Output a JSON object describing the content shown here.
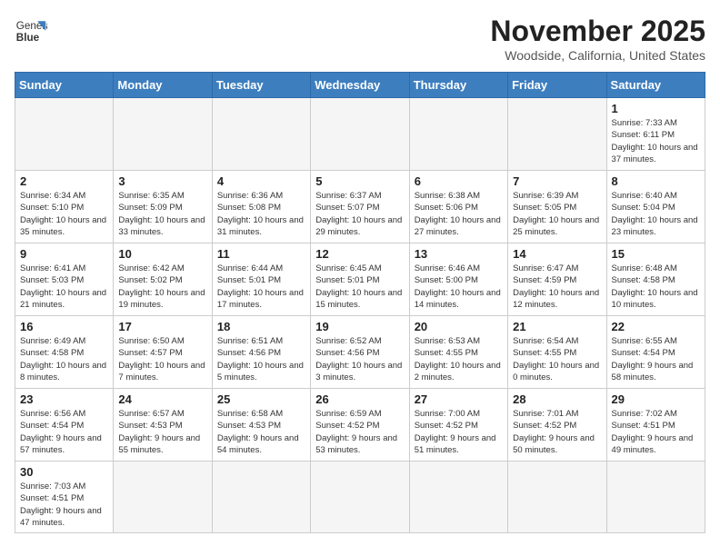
{
  "logo": {
    "text_normal": "General",
    "text_bold": "Blue"
  },
  "header": {
    "month": "November 2025",
    "location": "Woodside, California, United States"
  },
  "weekdays": [
    "Sunday",
    "Monday",
    "Tuesday",
    "Wednesday",
    "Thursday",
    "Friday",
    "Saturday"
  ],
  "weeks": [
    [
      {
        "day": "",
        "info": ""
      },
      {
        "day": "",
        "info": ""
      },
      {
        "day": "",
        "info": ""
      },
      {
        "day": "",
        "info": ""
      },
      {
        "day": "",
        "info": ""
      },
      {
        "day": "",
        "info": ""
      },
      {
        "day": "1",
        "info": "Sunrise: 7:33 AM\nSunset: 6:11 PM\nDaylight: 10 hours\nand 37 minutes."
      }
    ],
    [
      {
        "day": "2",
        "info": "Sunrise: 6:34 AM\nSunset: 5:10 PM\nDaylight: 10 hours\nand 35 minutes."
      },
      {
        "day": "3",
        "info": "Sunrise: 6:35 AM\nSunset: 5:09 PM\nDaylight: 10 hours\nand 33 minutes."
      },
      {
        "day": "4",
        "info": "Sunrise: 6:36 AM\nSunset: 5:08 PM\nDaylight: 10 hours\nand 31 minutes."
      },
      {
        "day": "5",
        "info": "Sunrise: 6:37 AM\nSunset: 5:07 PM\nDaylight: 10 hours\nand 29 minutes."
      },
      {
        "day": "6",
        "info": "Sunrise: 6:38 AM\nSunset: 5:06 PM\nDaylight: 10 hours\nand 27 minutes."
      },
      {
        "day": "7",
        "info": "Sunrise: 6:39 AM\nSunset: 5:05 PM\nDaylight: 10 hours\nand 25 minutes."
      },
      {
        "day": "8",
        "info": "Sunrise: 6:40 AM\nSunset: 5:04 PM\nDaylight: 10 hours\nand 23 minutes."
      }
    ],
    [
      {
        "day": "9",
        "info": "Sunrise: 6:41 AM\nSunset: 5:03 PM\nDaylight: 10 hours\nand 21 minutes."
      },
      {
        "day": "10",
        "info": "Sunrise: 6:42 AM\nSunset: 5:02 PM\nDaylight: 10 hours\nand 19 minutes."
      },
      {
        "day": "11",
        "info": "Sunrise: 6:44 AM\nSunset: 5:01 PM\nDaylight: 10 hours\nand 17 minutes."
      },
      {
        "day": "12",
        "info": "Sunrise: 6:45 AM\nSunset: 5:01 PM\nDaylight: 10 hours\nand 15 minutes."
      },
      {
        "day": "13",
        "info": "Sunrise: 6:46 AM\nSunset: 5:00 PM\nDaylight: 10 hours\nand 14 minutes."
      },
      {
        "day": "14",
        "info": "Sunrise: 6:47 AM\nSunset: 4:59 PM\nDaylight: 10 hours\nand 12 minutes."
      },
      {
        "day": "15",
        "info": "Sunrise: 6:48 AM\nSunset: 4:58 PM\nDaylight: 10 hours\nand 10 minutes."
      }
    ],
    [
      {
        "day": "16",
        "info": "Sunrise: 6:49 AM\nSunset: 4:58 PM\nDaylight: 10 hours\nand 8 minutes."
      },
      {
        "day": "17",
        "info": "Sunrise: 6:50 AM\nSunset: 4:57 PM\nDaylight: 10 hours\nand 7 minutes."
      },
      {
        "day": "18",
        "info": "Sunrise: 6:51 AM\nSunset: 4:56 PM\nDaylight: 10 hours\nand 5 minutes."
      },
      {
        "day": "19",
        "info": "Sunrise: 6:52 AM\nSunset: 4:56 PM\nDaylight: 10 hours\nand 3 minutes."
      },
      {
        "day": "20",
        "info": "Sunrise: 6:53 AM\nSunset: 4:55 PM\nDaylight: 10 hours\nand 2 minutes."
      },
      {
        "day": "21",
        "info": "Sunrise: 6:54 AM\nSunset: 4:55 PM\nDaylight: 10 hours\nand 0 minutes."
      },
      {
        "day": "22",
        "info": "Sunrise: 6:55 AM\nSunset: 4:54 PM\nDaylight: 9 hours\nand 58 minutes."
      }
    ],
    [
      {
        "day": "23",
        "info": "Sunrise: 6:56 AM\nSunset: 4:54 PM\nDaylight: 9 hours\nand 57 minutes."
      },
      {
        "day": "24",
        "info": "Sunrise: 6:57 AM\nSunset: 4:53 PM\nDaylight: 9 hours\nand 55 minutes."
      },
      {
        "day": "25",
        "info": "Sunrise: 6:58 AM\nSunset: 4:53 PM\nDaylight: 9 hours\nand 54 minutes."
      },
      {
        "day": "26",
        "info": "Sunrise: 6:59 AM\nSunset: 4:52 PM\nDaylight: 9 hours\nand 53 minutes."
      },
      {
        "day": "27",
        "info": "Sunrise: 7:00 AM\nSunset: 4:52 PM\nDaylight: 9 hours\nand 51 minutes."
      },
      {
        "day": "28",
        "info": "Sunrise: 7:01 AM\nSunset: 4:52 PM\nDaylight: 9 hours\nand 50 minutes."
      },
      {
        "day": "29",
        "info": "Sunrise: 7:02 AM\nSunset: 4:51 PM\nDaylight: 9 hours\nand 49 minutes."
      }
    ],
    [
      {
        "day": "30",
        "info": "Sunrise: 7:03 AM\nSunset: 4:51 PM\nDaylight: 9 hours\nand 47 minutes."
      },
      {
        "day": "",
        "info": ""
      },
      {
        "day": "",
        "info": ""
      },
      {
        "day": "",
        "info": ""
      },
      {
        "day": "",
        "info": ""
      },
      {
        "day": "",
        "info": ""
      },
      {
        "day": "",
        "info": ""
      }
    ]
  ]
}
